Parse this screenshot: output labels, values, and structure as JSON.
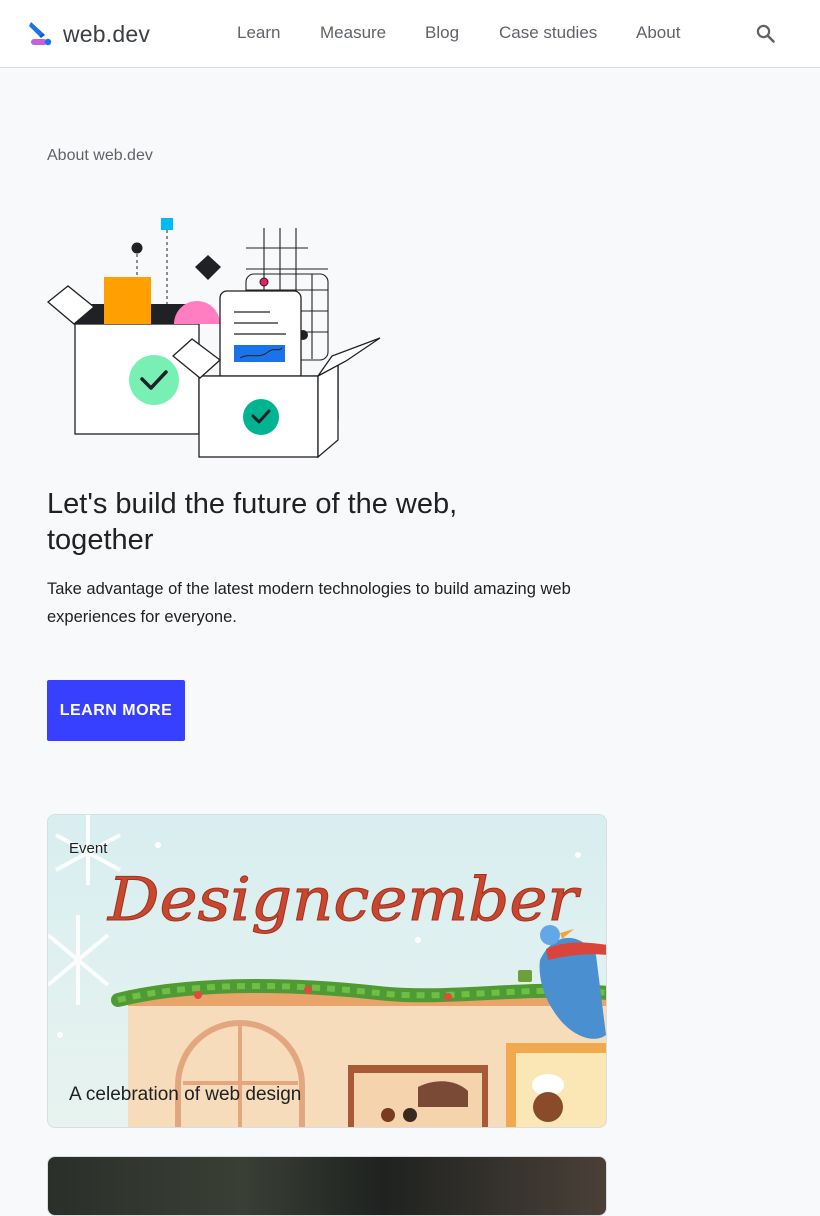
{
  "header": {
    "logo_text": "web.dev",
    "nav": [
      "Learn",
      "Measure",
      "Blog",
      "Case studies",
      "About"
    ],
    "search_icon": "search-icon"
  },
  "hero": {
    "eyebrow": "About web.dev",
    "title": "Let's build the future of the web, together",
    "description": "Take advantage of the latest modern technologies to build amazing web experiences for everyone.",
    "cta_label": "LEARN MORE"
  },
  "featured_card": {
    "tag": "Event",
    "art_lettering": "Designcember",
    "title": "A celebration of web design"
  },
  "colors": {
    "accent": "#3740ff",
    "page_background": "#f8f9fa",
    "header_background": "#ffffff",
    "text_primary": "#202124",
    "text_secondary": "#5f6368"
  }
}
